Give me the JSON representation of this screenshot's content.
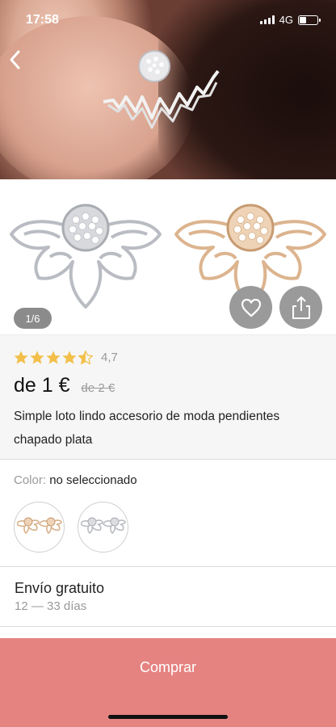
{
  "status_bar": {
    "time": "17:58",
    "network": "4G"
  },
  "gallery": {
    "page_indicator": "1/6"
  },
  "product": {
    "rating": "4,7",
    "stars": 4.5,
    "price": "de 1 €",
    "old_price": "de 2 €",
    "title": "Simple loto lindo accesorio de moda pendientes chapado plata"
  },
  "color": {
    "label": "Color:",
    "value": "no seleccionado"
  },
  "shipping": {
    "title": "Envío gratuito",
    "days": "12 — 33 días"
  },
  "actions": {
    "buy_label": "Comprar"
  },
  "colors": {
    "accent": "#e58381",
    "star": "#f2c04a"
  }
}
